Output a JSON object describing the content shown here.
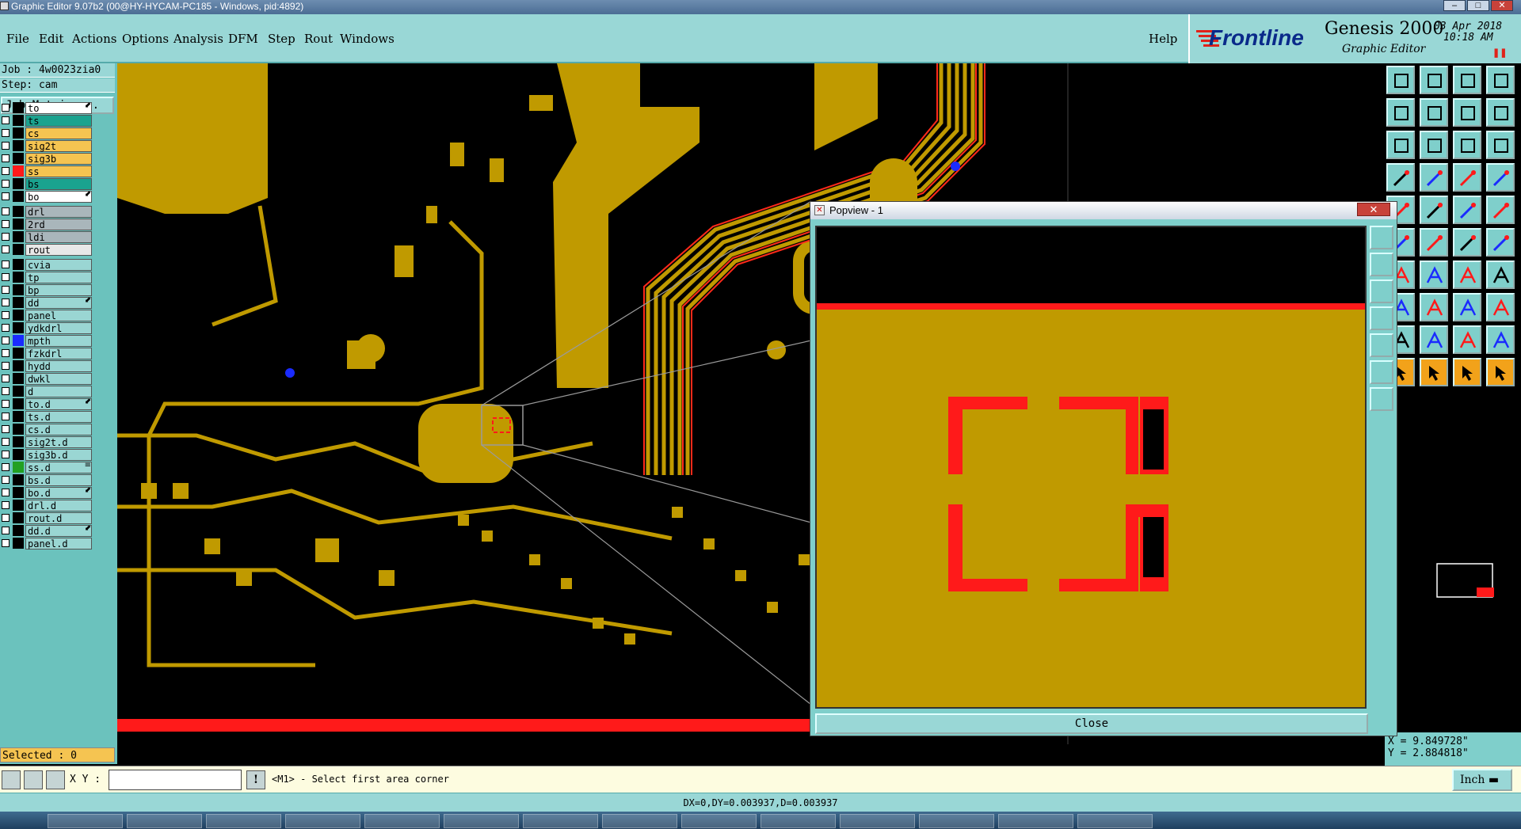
{
  "window": {
    "title": "Graphic Editor 9.07b2 (00@HY-HYCAM-PC185 - Windows, pid:4892)"
  },
  "menu": {
    "items": [
      "File",
      "Edit",
      "Actions",
      "Options",
      "Analysis",
      "DFM",
      "Step",
      "Rout",
      "Windows"
    ],
    "help": "Help"
  },
  "brand": {
    "logo": "Frontline",
    "product": "Genesis 2000",
    "subtitle": "Graphic Editor",
    "date": "03 Apr 2018",
    "time": "10:18 AM"
  },
  "job": {
    "label": "Job : 4w0023zia0",
    "step": "Step: cam",
    "matrix_button": "Job Matrix ..."
  },
  "layers": [
    {
      "name": "to",
      "color": "#ffffff",
      "swatch": "#000000",
      "mark": "⬋"
    },
    {
      "name": "ts",
      "color": "#1aa38f",
      "swatch": "#000000",
      "mark": ""
    },
    {
      "name": "cs",
      "color": "#f5c451",
      "swatch": "#000000",
      "mark": ""
    },
    {
      "name": "sig2t",
      "color": "#f5c451",
      "swatch": "#000000",
      "mark": ""
    },
    {
      "name": "sig3b",
      "color": "#f5c451",
      "swatch": "#000000",
      "mark": ""
    },
    {
      "name": "ss",
      "color": "#f5c451",
      "swatch": "#ff1a1a",
      "mark": ""
    },
    {
      "name": "bs",
      "color": "#1aa38f",
      "swatch": "#000000",
      "mark": ""
    },
    {
      "name": "bo",
      "color": "#ffffff",
      "swatch": "#000000",
      "mark": "⬋"
    },
    {
      "name": "drl",
      "color": "#a9b6bb",
      "swatch": "#000000",
      "mark": ""
    },
    {
      "name": "2rd",
      "color": "#a9b6bb",
      "swatch": "#000000",
      "mark": ""
    },
    {
      "name": "ldi",
      "color": "#a9b6bb",
      "swatch": "#000000",
      "mark": ""
    },
    {
      "name": "rout",
      "color": "#e8e8e8",
      "swatch": "#000000",
      "mark": ""
    },
    {
      "name": "cvia",
      "color": "#9ad6d3",
      "swatch": "#000000",
      "mark": ""
    },
    {
      "name": "tp",
      "color": "#9ad6d3",
      "swatch": "#000000",
      "mark": ""
    },
    {
      "name": "bp",
      "color": "#9ad6d3",
      "swatch": "#000000",
      "mark": ""
    },
    {
      "name": "dd",
      "color": "#9ad6d3",
      "swatch": "#000000",
      "mark": "⬋"
    },
    {
      "name": "panel",
      "color": "#9ad6d3",
      "swatch": "#000000",
      "mark": ""
    },
    {
      "name": "ydkdrl",
      "color": "#9ad6d3",
      "swatch": "#000000",
      "mark": ""
    },
    {
      "name": "mpth",
      "color": "#9ad6d3",
      "swatch": "#1a2bff",
      "mark": ""
    },
    {
      "name": "fzkdrl",
      "color": "#9ad6d3",
      "swatch": "#000000",
      "mark": ""
    },
    {
      "name": "hydd",
      "color": "#9ad6d3",
      "swatch": "#000000",
      "mark": ""
    },
    {
      "name": "dwkl",
      "color": "#9ad6d3",
      "swatch": "#000000",
      "mark": ""
    },
    {
      "name": "d",
      "color": "#9ad6d3",
      "swatch": "#000000",
      "mark": ""
    },
    {
      "name": "to.d",
      "color": "#9ad6d3",
      "swatch": "#000000",
      "mark": "⬋"
    },
    {
      "name": "ts.d",
      "color": "#9ad6d3",
      "swatch": "#000000",
      "mark": ""
    },
    {
      "name": "cs.d",
      "color": "#9ad6d3",
      "swatch": "#000000",
      "mark": ""
    },
    {
      "name": "sig2t.d",
      "color": "#9ad6d3",
      "swatch": "#000000",
      "mark": ""
    },
    {
      "name": "sig3b.d",
      "color": "#9ad6d3",
      "swatch": "#000000",
      "mark": ""
    },
    {
      "name": "ss.d",
      "color": "#9ad6d3",
      "swatch": "#22a022",
      "mark": "≡"
    },
    {
      "name": "bs.d",
      "color": "#9ad6d3",
      "swatch": "#000000",
      "mark": ""
    },
    {
      "name": "bo.d",
      "color": "#9ad6d3",
      "swatch": "#000000",
      "mark": "⬋"
    },
    {
      "name": "drl.d",
      "color": "#9ad6d3",
      "swatch": "#000000",
      "mark": ""
    },
    {
      "name": "rout.d",
      "color": "#9ad6d3",
      "swatch": "#000000",
      "mark": ""
    },
    {
      "name": "dd.d",
      "color": "#9ad6d3",
      "swatch": "#000000",
      "mark": "⬋"
    },
    {
      "name": "panel.d",
      "color": "#9ad6d3",
      "swatch": "#000000",
      "mark": ""
    }
  ],
  "selected": "Selected : 0",
  "popview": {
    "title": "Popview - 1",
    "close_button": "Close",
    "close_x": "✕"
  },
  "coords": {
    "x": "X = 9.849728\"",
    "y": "Y = 2.884818\""
  },
  "command": {
    "xy_label": "X Y :",
    "xy_value": "",
    "prompt": "<M1> - Select first area corner",
    "units": "Inch"
  },
  "status": {
    "text": "DX=0,DY=0.003937,D=0.003937"
  },
  "colors": {
    "copper": "#c09a00",
    "highlight": "#ff1a1a",
    "ui": "#99d7d6"
  },
  "toolbar_icons": [
    "zoom-home-icon",
    "zoom-in-icon",
    "home-icon",
    "panel-icon",
    "zoom-prev-icon",
    "zoom-next-icon",
    "pan-icon",
    "pan-page-icon",
    "fit-icon",
    "fit-profile-icon",
    "one-to-one-icon",
    "help-query-icon",
    "measure-icon",
    "grid-icon",
    "snap-icon",
    "layers-icon",
    "rotate-icon",
    "graph-icon",
    "ruler-icon",
    "dot-icon",
    "sel-icon",
    "cross-icon",
    "line-icon",
    "line2-icon",
    "slash-icon",
    "slash2-icon",
    "arc-icon",
    "ff-icon",
    "dash-icon",
    "stretch-icon",
    "move-icon",
    "copy-icon",
    "text-a-icon",
    "text-a2-icon",
    "text-a3-icon",
    "text-a4-icon",
    "pointer-icon",
    "pointer2-icon",
    "pointer3-icon",
    "pointer4-icon"
  ]
}
